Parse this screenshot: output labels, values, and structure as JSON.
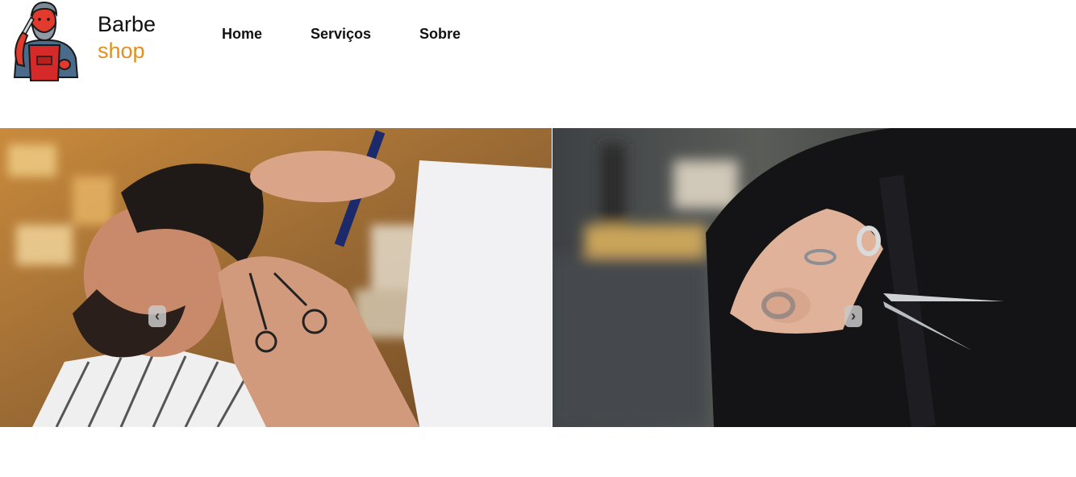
{
  "brand": {
    "line1": "Barbe",
    "line2": "shop",
    "accent_color": "#e2901f"
  },
  "nav": {
    "items": [
      "Home",
      "Serviços",
      "Sobre"
    ]
  },
  "carousel": {
    "prev_icon": "chevron-left",
    "next_icon": "chevron-right",
    "prev_glyph": "‹",
    "next_glyph": "›"
  }
}
